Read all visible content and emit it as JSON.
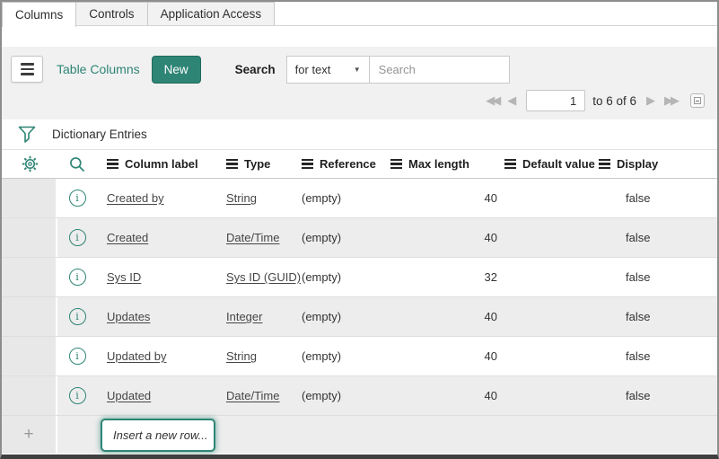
{
  "tabs": [
    {
      "label": "Columns",
      "active": true
    },
    {
      "label": "Controls",
      "active": false
    },
    {
      "label": "Application Access",
      "active": false
    }
  ],
  "toolbar": {
    "title": "Table Columns",
    "new_button": "New",
    "search_label": "Search",
    "search_type_value": "for text",
    "search_placeholder": "Search"
  },
  "pagination": {
    "current_page": "1",
    "range_text": "to 6 of 6",
    "first_icon": "◀◀",
    "prev_icon": "◀",
    "next_icon": "▶",
    "last_icon": "▶▶"
  },
  "list": {
    "title": "Dictionary Entries"
  },
  "table": {
    "headers": [
      "Column label",
      "Type",
      "Reference",
      "Max length",
      "Default value",
      "Display"
    ],
    "rows": [
      {
        "label": "Created by",
        "type": "String",
        "reference": "(empty)",
        "max_length": "40",
        "default_value": "",
        "display": "false"
      },
      {
        "label": "Created",
        "type": "Date/Time",
        "reference": "(empty)",
        "max_length": "40",
        "default_value": "",
        "display": "false"
      },
      {
        "label": "Sys ID",
        "type": "Sys ID (GUID)",
        "reference": "(empty)",
        "max_length": "32",
        "default_value": "",
        "display": "false"
      },
      {
        "label": "Updates",
        "type": "Integer",
        "reference": "(empty)",
        "max_length": "40",
        "default_value": "",
        "display": "false"
      },
      {
        "label": "Updated by",
        "type": "String",
        "reference": "(empty)",
        "max_length": "40",
        "default_value": "",
        "display": "false"
      },
      {
        "label": "Updated",
        "type": "Date/Time",
        "reference": "(empty)",
        "max_length": "40",
        "default_value": "",
        "display": "false"
      }
    ],
    "insert_placeholder": "Insert a new row...",
    "plus_icon": "+"
  },
  "colors": {
    "accent": "#2e8575",
    "stripe": "#ededed",
    "toolbar_bg": "#f1f1f1"
  }
}
